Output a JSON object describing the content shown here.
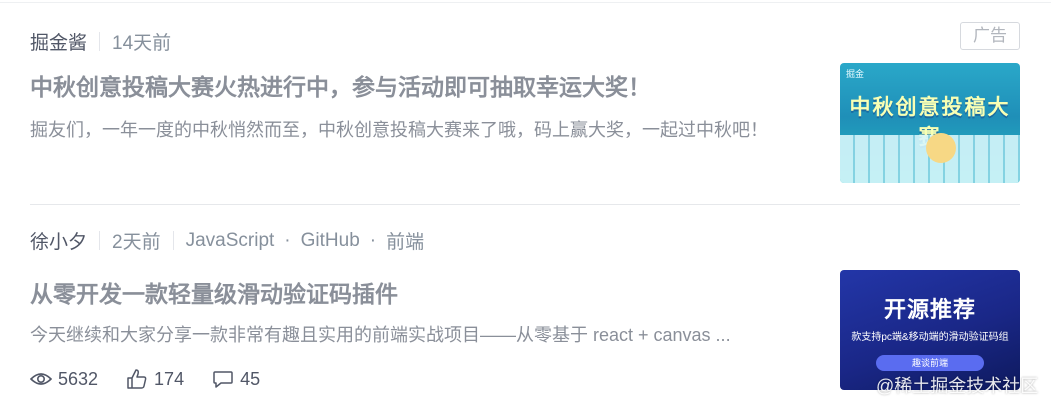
{
  "feed": {
    "entries": [
      {
        "author": "掘金酱",
        "time": "14天前",
        "ad_label": "广告",
        "title": "中秋创意投稿大赛火热进行中，参与活动即可抽取幸运大奖！",
        "abstract": "掘友们，一年一度的中秋悄然而至，中秋创意投稿大赛来了哦，码上赢大奖，一起过中秋吧！",
        "thumbnail": {
          "logo": "掘金",
          "title": "中秋创意投稿大赛"
        }
      },
      {
        "author": "徐小夕",
        "time": "2天前",
        "tags": [
          "JavaScript",
          "GitHub",
          "前端"
        ],
        "tag_separator": "·",
        "title": "从零开发一款轻量级滑动验证码插件",
        "abstract": "今天继续和大家分享一款非常有趣且实用的前端实战项目——从零基于 react + canvas ...",
        "thumbnail": {
          "title": "开源推荐",
          "subtitle": "款支持pc端&移动端的滑动验证码组",
          "button": "趣谈前端"
        },
        "stats": {
          "views": "5632",
          "likes": "174",
          "comments": "45"
        }
      }
    ]
  },
  "watermark": "@稀土掘金技术社区",
  "icons": {
    "views": "eye-icon",
    "likes": "thumb-up-icon",
    "comments": "comment-icon"
  }
}
